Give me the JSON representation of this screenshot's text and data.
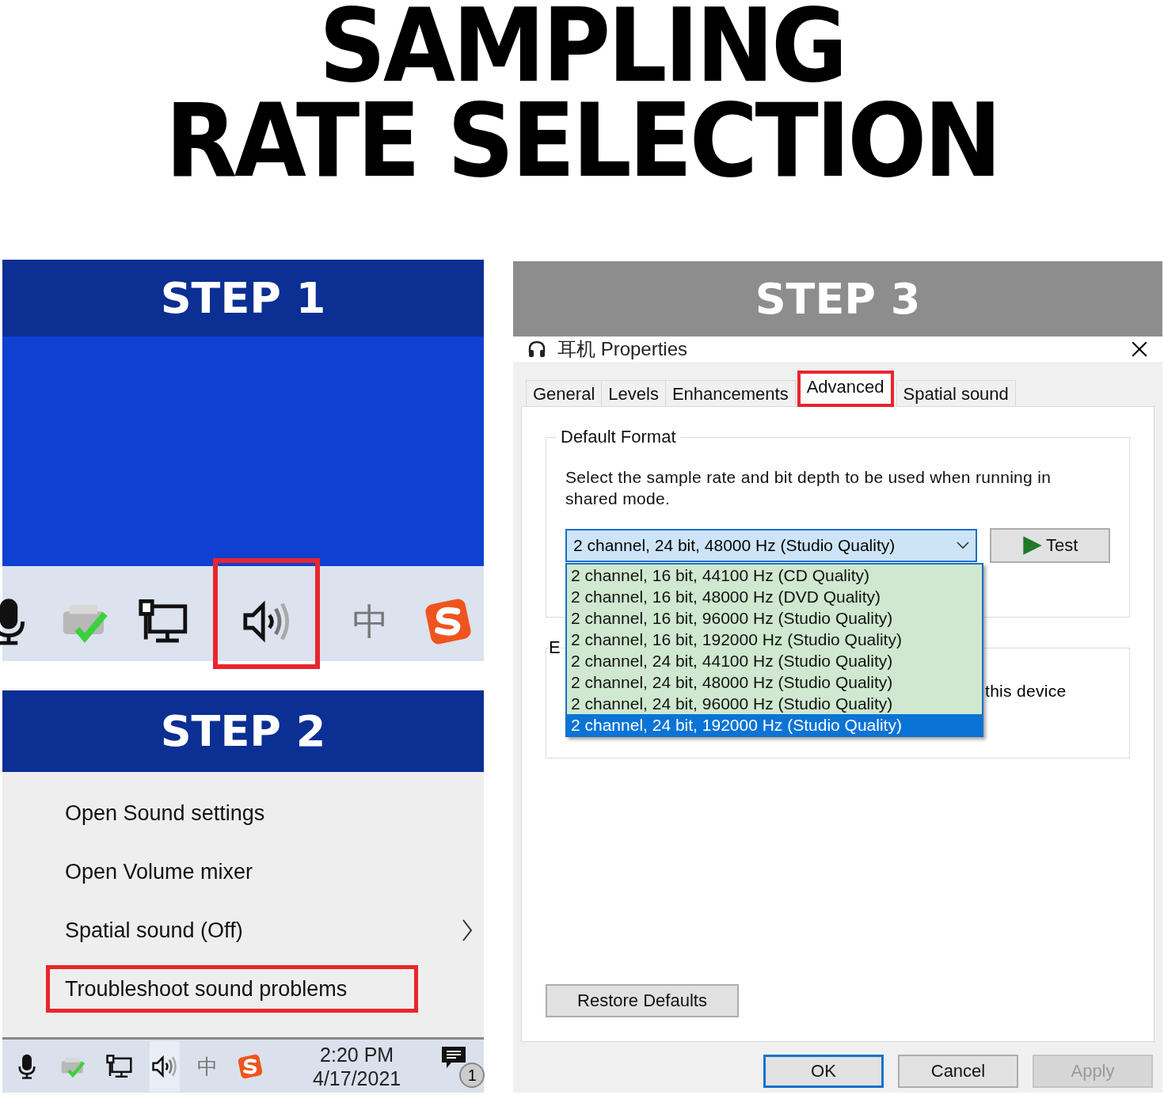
{
  "title": [
    "SAMPLING",
    "RATE SELECTION"
  ],
  "step1": {
    "heading": "STEP 1",
    "tray": [
      {
        "kind": "microphone",
        "highlighted": false
      },
      {
        "kind": "printer",
        "highlighted": false
      },
      {
        "kind": "network",
        "highlighted": false
      },
      {
        "kind": "speaker",
        "highlighted": true
      },
      {
        "kind": "ime",
        "label": "中",
        "highlighted": false
      },
      {
        "kind": "app",
        "highlighted": false
      }
    ]
  },
  "step2": {
    "heading": "STEP 2",
    "menu": [
      {
        "label": "Open Sound settings",
        "submenu": false,
        "highlighted": false
      },
      {
        "label": "Open Volume mixer",
        "submenu": false,
        "highlighted": false
      },
      {
        "label": "Spatial sound (Off)",
        "submenu": true,
        "highlighted": false
      },
      {
        "label": "Troubleshoot sound problems",
        "submenu": false,
        "highlighted": true
      }
    ],
    "tray": [
      {
        "kind": "microphone",
        "highlighted": false
      },
      {
        "kind": "printer",
        "highlighted": false
      },
      {
        "kind": "network",
        "highlighted": false
      },
      {
        "kind": "speaker",
        "highlighted": true
      },
      {
        "kind": "ime",
        "label": "中",
        "highlighted": false
      },
      {
        "kind": "app",
        "highlighted": false
      }
    ],
    "time": "2:20 PM",
    "date": "4/17/2021",
    "notification_count": "1"
  },
  "step3": {
    "heading": "STEP 3",
    "window": {
      "title": "耳机 Properties",
      "tabs": [
        {
          "label": "General",
          "selected": false,
          "highlighted": false
        },
        {
          "label": "Levels",
          "selected": false,
          "highlighted": false
        },
        {
          "label": "Enhancements",
          "selected": false,
          "highlighted": false
        },
        {
          "label": "Advanced",
          "selected": true,
          "highlighted": true
        },
        {
          "label": "Spatial sound",
          "selected": false,
          "highlighted": false
        }
      ],
      "group_title": "Default Format",
      "description": "Select the sample rate and bit depth to be used when running in shared mode.",
      "format_value": "2 channel, 24 bit, 48000 Hz (Studio Quality)",
      "options": [
        {
          "label": "2 channel, 16 bit, 44100 Hz (CD Quality)",
          "selected": false
        },
        {
          "label": "2 channel, 16 bit, 48000 Hz (DVD Quality)",
          "selected": false
        },
        {
          "label": "2 channel, 16 bit, 96000 Hz (Studio Quality)",
          "selected": false
        },
        {
          "label": "2 channel, 16 bit, 192000 Hz (Studio Quality)",
          "selected": false
        },
        {
          "label": "2 channel, 24 bit, 44100 Hz (Studio Quality)",
          "selected": false
        },
        {
          "label": "2 channel, 24 bit, 48000 Hz (Studio Quality)",
          "selected": false
        },
        {
          "label": "2 channel, 24 bit, 96000 Hz (Studio Quality)",
          "selected": false
        },
        {
          "label": "2 channel, 24 bit, 192000 Hz (Studio Quality)",
          "selected": true
        }
      ],
      "test_button": "Test",
      "second_group_label": "E",
      "second_group_text": "this device",
      "restore_button": "Restore Defaults",
      "buttons": [
        {
          "label": "OK",
          "kind": "default"
        },
        {
          "label": "Cancel",
          "kind": "normal"
        },
        {
          "label": "Apply",
          "kind": "disabled"
        }
      ]
    }
  }
}
